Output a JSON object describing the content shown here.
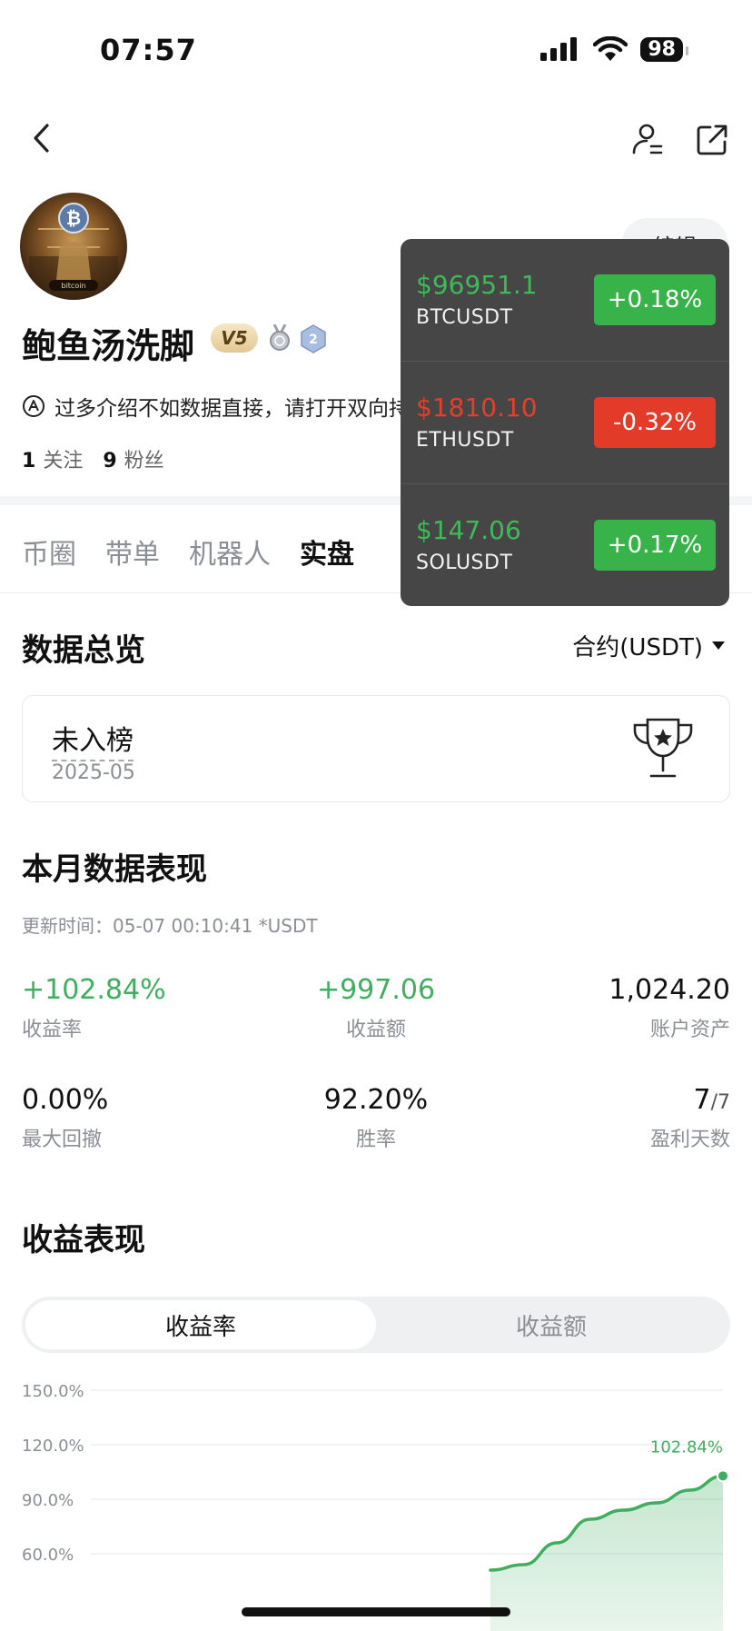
{
  "status_bar": {
    "time": "07:57",
    "battery": "98"
  },
  "profile": {
    "name": "鲍鱼汤洗脚",
    "vip_badge": "V5",
    "level": "2",
    "edit_label": "编辑",
    "bio": "过多介绍不如数据直接，请打开双向持仓",
    "following_count": "1",
    "following_label": "关注",
    "followers_count": "9",
    "followers_label": "粉丝",
    "avatar_text": "bitcoin"
  },
  "tabs": [
    "币圈",
    "带单",
    "机器人",
    "实盘"
  ],
  "ticker": [
    {
      "price": "$96951.1",
      "symbol": "BTCUSDT",
      "change": "+0.18%",
      "direction": "up"
    },
    {
      "price": "$1810.10",
      "symbol": "ETHUSDT",
      "change": "-0.32%",
      "direction": "down"
    },
    {
      "price": "$147.06",
      "symbol": "SOLUSDT",
      "change": "+0.17%",
      "direction": "up"
    }
  ],
  "overview": {
    "title": "数据总览",
    "contract_select": "合约(USDT)",
    "rank_status": "未入榜",
    "rank_date": "2025-05"
  },
  "monthly": {
    "title": "本月数据表现",
    "update_time": "更新时间：05-07 00:10:41  *USDT",
    "return_rate": "+102.84%",
    "return_rate_label": "收益率",
    "profit": "+997.06",
    "profit_label": "收益额",
    "assets": "1,024.20",
    "assets_label": "账户资产",
    "max_drawdown": "0.00%",
    "max_drawdown_label": "最大回撤",
    "win_rate": "92.20%",
    "win_rate_label": "胜率",
    "profit_days": "7",
    "profit_days_total": "/7",
    "profit_days_label": "盈利天数"
  },
  "performance": {
    "title": "收益表现",
    "segment_active": "收益率",
    "segment_inactive": "收益额"
  },
  "colors": {
    "up": "#3fae5e",
    "down": "#e23b2a",
    "ticker_bg": "#464646"
  },
  "chart_data": {
    "type": "area",
    "y_ticks": [
      "150.0%",
      "120.0%",
      "90.0%",
      "60.0%"
    ],
    "ylim": [
      60,
      150
    ],
    "x": [
      0,
      1,
      2,
      3,
      4,
      5,
      6,
      7
    ],
    "values": [
      51,
      54,
      66,
      79,
      84,
      88,
      95,
      102.84
    ],
    "end_label": "102.84%",
    "grid": true
  }
}
